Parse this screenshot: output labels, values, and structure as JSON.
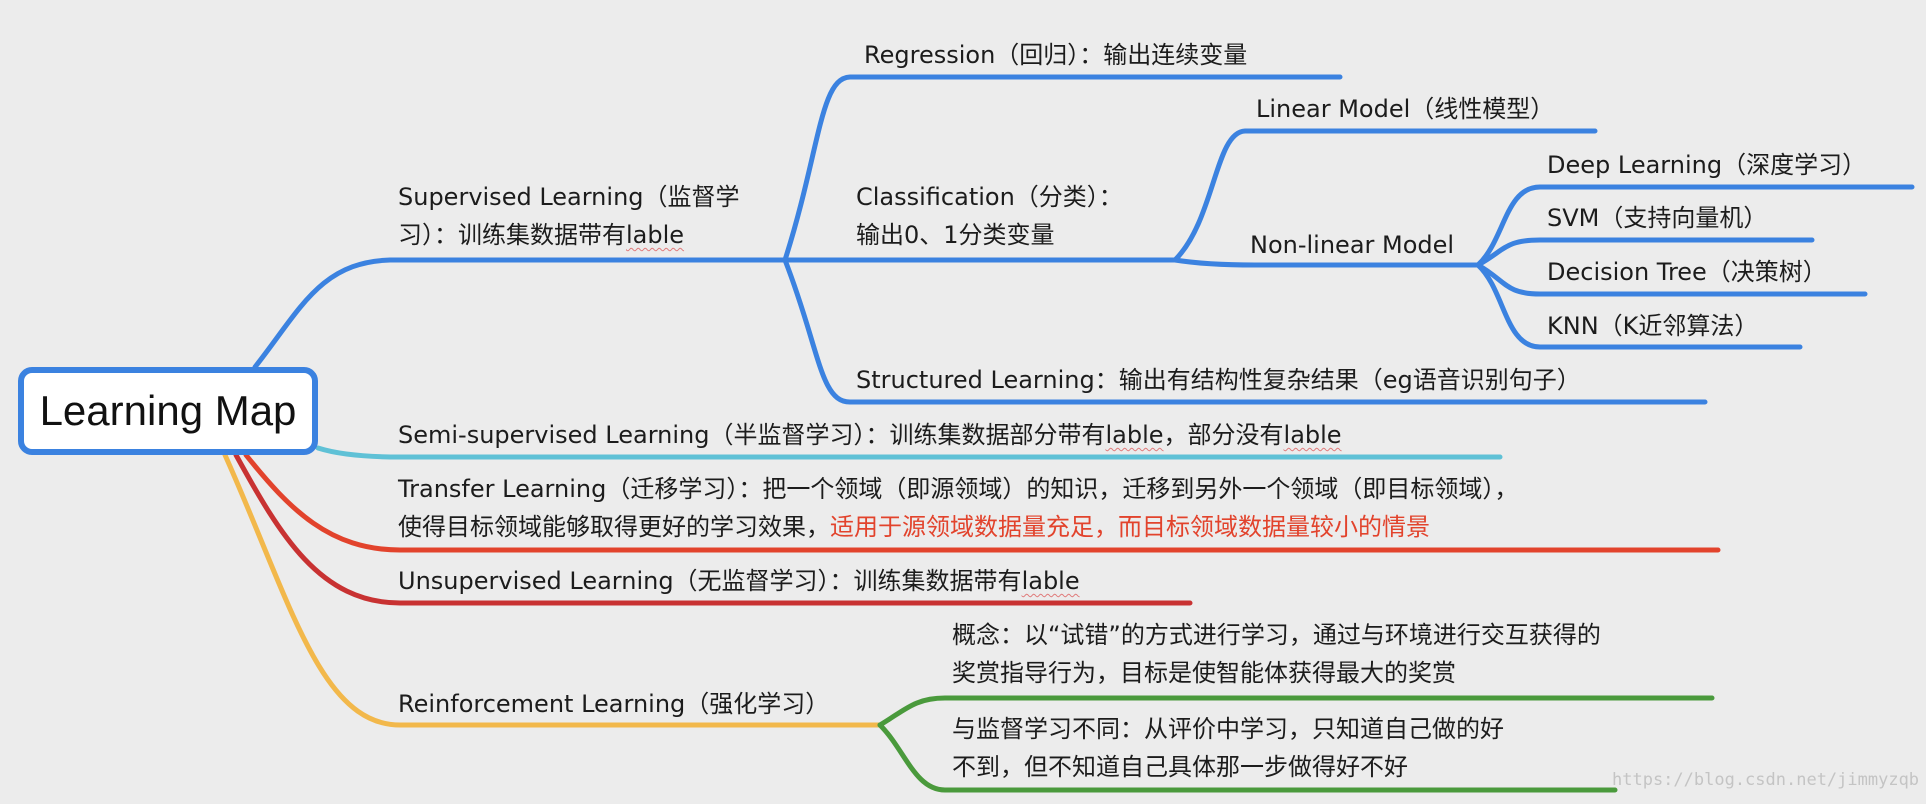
{
  "root": {
    "label": "Learning Map"
  },
  "colors": {
    "supervised": "#3b82e0",
    "semi_supervised": "#5fc1d6",
    "transfer": "#e2432c",
    "unsupervised": "#c83232",
    "reinforcement": "#f2b84b",
    "reinforcement_children": "#4a9a3c",
    "note_red": "#e2432c"
  },
  "branches": {
    "supervised": {
      "line1": "Supervised Learning（监督学",
      "line2_prefix": "习）：训练集数据带有",
      "line2_word": "lable",
      "children": {
        "regression": {
          "label": "Regression（回归）：输出连续变量"
        },
        "classification": {
          "line1": "Classification（分类）：",
          "line2": "输出0、1分类变量",
          "children": {
            "linear": {
              "label": "Linear Model（线性模型）"
            },
            "nonlinear": {
              "label": "Non-linear Model",
              "children": {
                "deep_learning": "Deep Learning（深度学习）",
                "svm": "SVM（支持向量机）",
                "decision_tree": "Decision Tree（决策树）",
                "knn": "KNN（K近邻算法）"
              }
            }
          }
        },
        "structured": {
          "label": "Structured Learning：输出有结构性复杂结果（eg语音识别句子）"
        }
      }
    },
    "semi_supervised": {
      "prefix": "Semi-supervised Learning（半监督学习）：训练集数据部分带有",
      "word1": "lable",
      "middle": "，部分没有",
      "word2": "lable"
    },
    "transfer": {
      "line1": "Transfer Learning（迁移学习）：把一个领域（即源领域）的知识，迁移到另外一个领域（即目标领域），",
      "line2_black": "使得目标领域能够取得更好的学习效果，",
      "line2_red": "适用于源领域数据量充足，而目标领域数据量较小的情景"
    },
    "unsupervised": {
      "prefix": "Unsupervised Learning（无监督学习）：训练集数据带有",
      "word": "lable"
    },
    "reinforcement": {
      "label": "Reinforcement Learning（强化学习）",
      "children": {
        "concept": {
          "line1": "概念：以“试错”的方式进行学习，通过与环境进行交互获得的",
          "line2": "奖赏指导行为，目标是使智能体获得最大的奖赏"
        },
        "difference": {
          "line1": "与监督学习不同：从评价中学习，只知道自己做的好",
          "line2": "不到，但不知道自己具体那一步做得好不好"
        }
      }
    }
  },
  "watermark": "https://blog.csdn.net/jimmyzqb"
}
